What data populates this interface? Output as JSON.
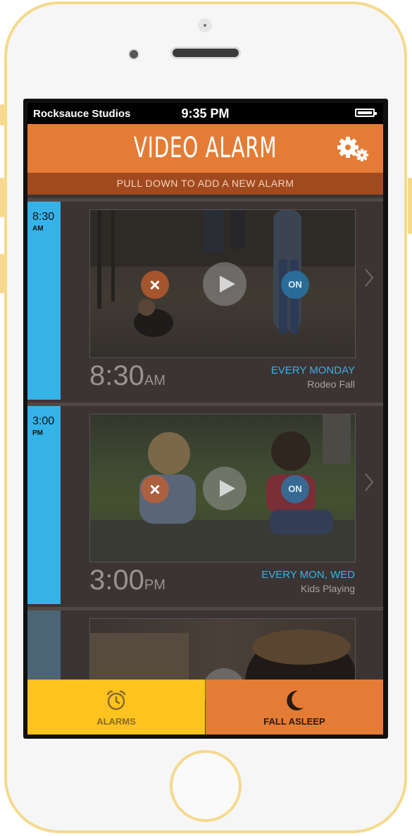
{
  "status_bar": {
    "carrier": "Rocksauce Studios",
    "time": "9:35 PM"
  },
  "header": {
    "title": "VIDEO ALARM",
    "subtitle": "PULL DOWN TO ADD A NEW ALARM"
  },
  "alarms": [
    {
      "side_time": "8:30",
      "side_ampm": "AM",
      "time": "8:30",
      "ampm": "AM",
      "repeat": "EVERY MONDAY",
      "label": "Rodeo Fall",
      "on_label": "ON"
    },
    {
      "side_time": "3:00",
      "side_ampm": "PM",
      "time": "3:00",
      "ampm": "PM",
      "repeat": "EVERY MON, WED",
      "label": "Kids Playing",
      "on_label": "ON"
    }
  ],
  "tabs": {
    "alarms": "ALARMS",
    "fall_asleep": "FALL ASLEEP"
  },
  "colors": {
    "accent_orange": "#e57c35",
    "accent_blue": "#35b3e8",
    "accent_yellow": "#fec31e",
    "background": "#3b3433"
  }
}
